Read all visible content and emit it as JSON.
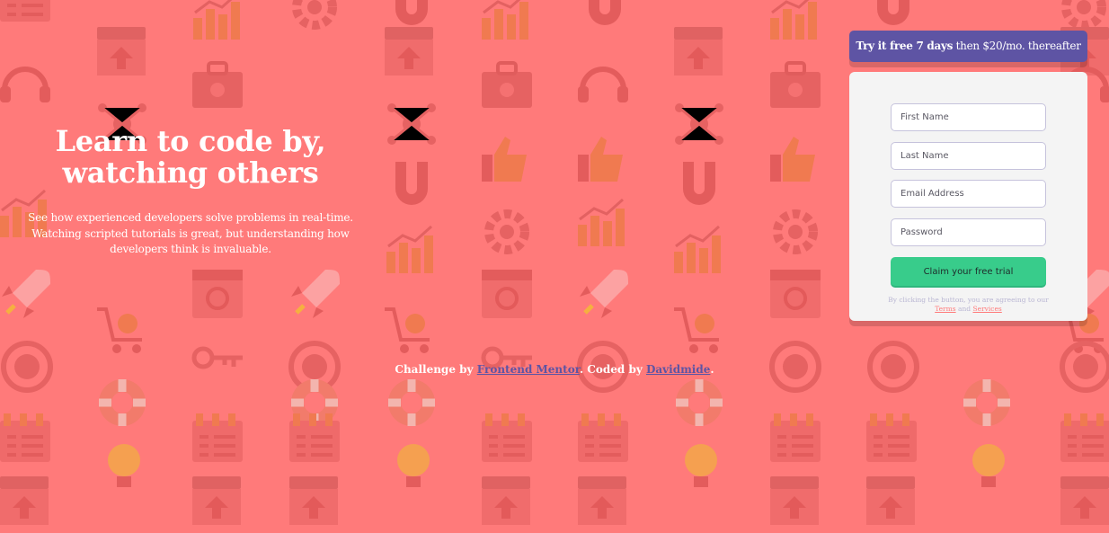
{
  "hero": {
    "title_line1": "Learn to code by,",
    "title_line2": "watching others",
    "description_line1": "See how experienced developers solve problems in real-time.",
    "description_line2": "Watching scripted tutorials is great, but understanding how",
    "description_line3": "developers think is invaluable."
  },
  "trial_banner": {
    "bold_text": "Try it free 7 days",
    "rest_text": "then $20/mo. thereafter"
  },
  "form": {
    "first_name": {
      "placeholder": "First Name",
      "value": ""
    },
    "last_name": {
      "placeholder": "Last Name",
      "value": ""
    },
    "email": {
      "placeholder": "Email Address",
      "value": ""
    },
    "password": {
      "placeholder": "Password",
      "value": ""
    },
    "submit_label": "Claim your free trial",
    "terms_prefix": "By clicking the button, you are agreeing to our",
    "terms_link": "Terms",
    "terms_and": "and",
    "services_link": "Services"
  },
  "footer": {
    "prefix": "Challenge by",
    "frontend_mentor_link": "Frontend Mentor",
    "coded_by": ". Coded by",
    "author_link": "Davidmide",
    "suffix": "."
  },
  "colors": {
    "background": "#ff7a7a",
    "accent_purple": "#5e54a4",
    "accent_green": "#38cc8b",
    "card": "#f4f4f4"
  },
  "background_icons": [
    "magnet-icon",
    "browser-icon",
    "toolbox-icon",
    "headset-icon",
    "network-icon",
    "chart-icon",
    "gear-icon",
    "rocket-icon",
    "search-icon",
    "cart-icon",
    "key-icon",
    "globe-icon",
    "lifebuoy-icon",
    "calendar-icon",
    "lightbulb-icon",
    "sitemap-icon",
    "thumbs-up-icon",
    "pencil-icon"
  ]
}
